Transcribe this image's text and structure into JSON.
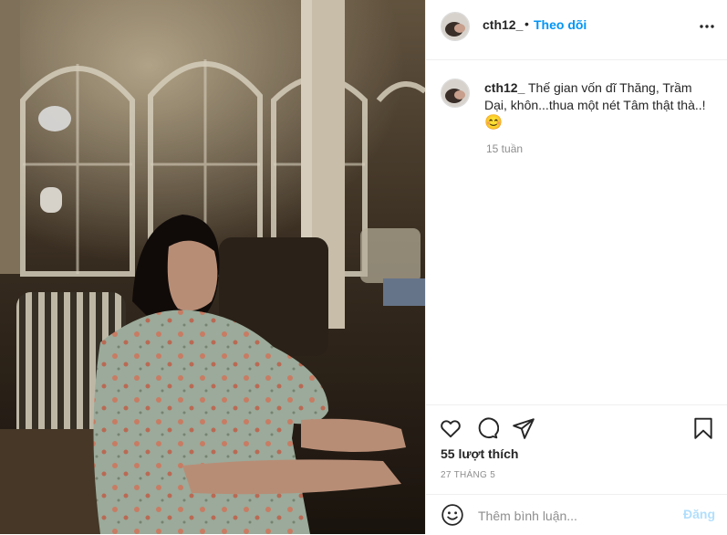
{
  "post": {
    "username": "cth12_",
    "separator": "•",
    "follow_label": "Theo dõi",
    "caption_text": "Thế gian vốn dĩ Thăng, Trầm Dại, khôn...thua một nét Tâm thật thà..!",
    "caption_emoji": "😊",
    "time_ago": "15 tuần",
    "likes": "55 lượt thích",
    "date": "27 THÁNG 5"
  },
  "comment": {
    "placeholder": "Thêm bình luận...",
    "post_label": "Đăng"
  },
  "icons": {
    "more": "more-options-icon",
    "like": "heart-icon",
    "comment": "comment-icon",
    "share": "share-icon",
    "save": "bookmark-icon",
    "emoji": "emoji-icon"
  },
  "colors": {
    "accent": "#0095f6",
    "post_disabled": "#b2dffc",
    "muted": "#8e8e8e",
    "border": "#efefef"
  }
}
